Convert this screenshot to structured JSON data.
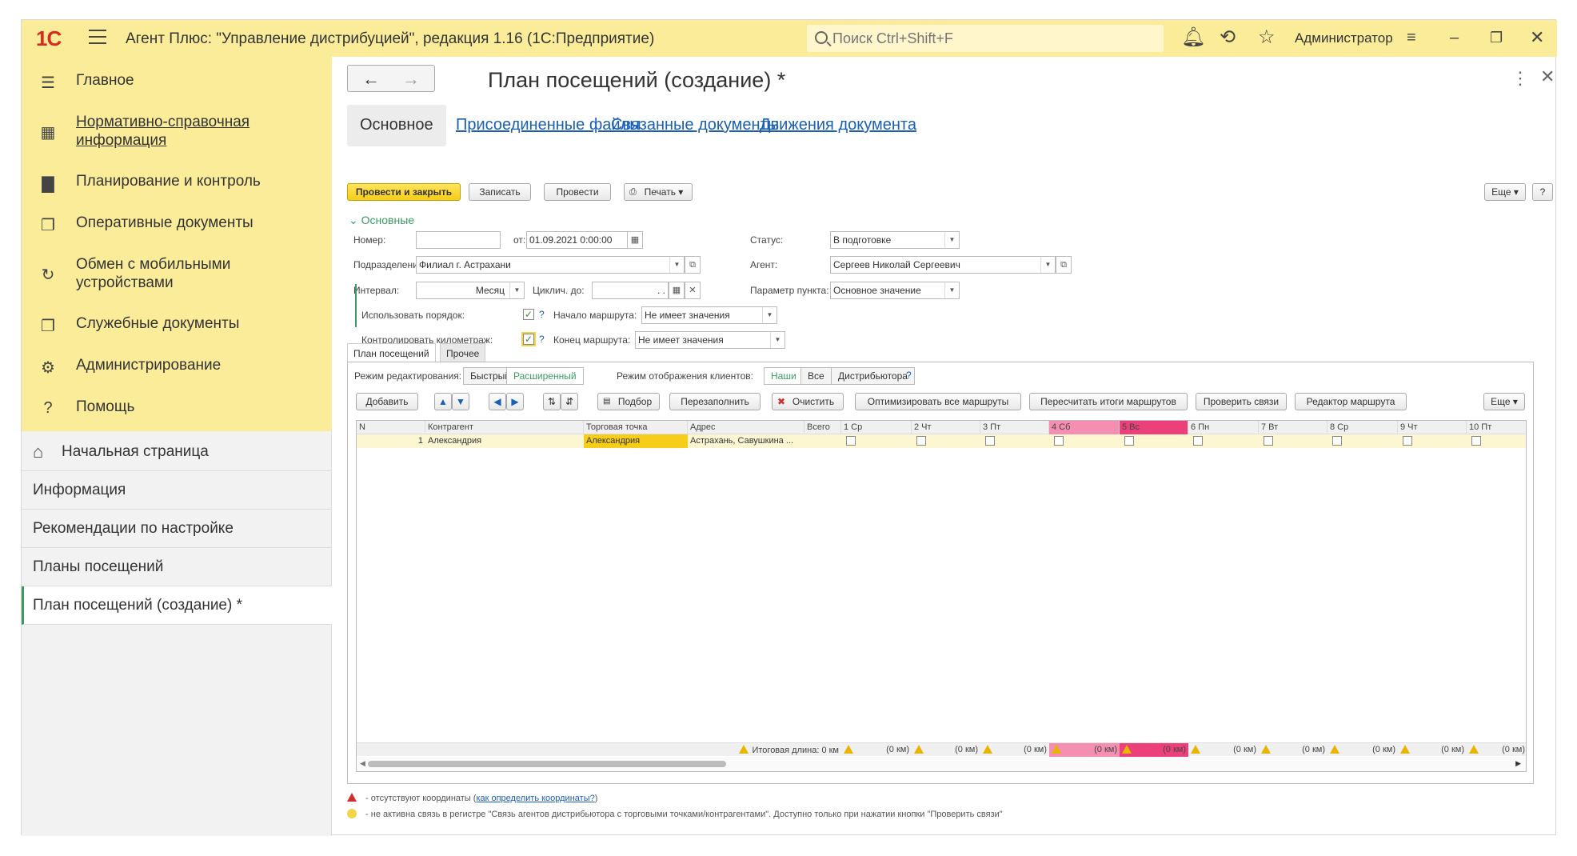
{
  "app": {
    "logo": "1С",
    "title": "Агент Плюс: \"Управление дистрибуцией\", редакция 1.16  (1С:Предприятие)",
    "search_placeholder": "Поиск Ctrl+Shift+F",
    "user": "Администратор"
  },
  "sidebar": {
    "items": [
      {
        "label": "Главное",
        "icon": "menu-lines-icon"
      },
      {
        "label": "Нормативно-справочная информация",
        "icon": "grid-table-icon"
      },
      {
        "label": "Планирование и контроль",
        "icon": "bar-chart-icon"
      },
      {
        "label": "Оперативные документы",
        "icon": "documents-icon"
      },
      {
        "label": "Обмен с мобильными устройствами",
        "icon": "sync-icon"
      },
      {
        "label": "Служебные документы",
        "icon": "service-documents-icon"
      },
      {
        "label": "Администрирование",
        "icon": "gear-icon"
      },
      {
        "label": "Помощь",
        "icon": "question-icon"
      }
    ],
    "open_tabs": [
      {
        "label": "Начальная страница",
        "icon": "home-icon"
      },
      {
        "label": "Информация"
      },
      {
        "label": "Рекомендации по настройке"
      },
      {
        "label": "Планы посещений"
      },
      {
        "label": "План посещений  (создание) *"
      }
    ]
  },
  "form": {
    "title": "План посещений  (создание) *",
    "tabs": [
      "Основное",
      "Присоединенные файлы",
      "Связанные документы",
      "Движения документа"
    ],
    "toolbar": {
      "post_close": "Провести и закрыть",
      "save": "Записать",
      "post": "Провести",
      "print": "Печать",
      "more": "Еще",
      "help": "?"
    },
    "section_title": "Основные",
    "fields": {
      "number_label": "Номер:",
      "number_value": "",
      "from_label": "от:",
      "from_value": "01.09.2021  0:00:00",
      "status_label": "Статус:",
      "status_value": "В подготовке",
      "division_label": "Подразделение:",
      "division_value": "Филиал г. Астрахани",
      "agent_label": "Агент:",
      "agent_value": "Сергеев Николай Сергеевич",
      "interval_label": "Интервал:",
      "interval_value": "Месяц",
      "cyclic_label": "Циклич. до:",
      "cyclic_value": "  .  .",
      "point_param_label": "Параметр пункта:",
      "point_param_value": "Основное значение",
      "use_order_label": "Использовать порядок:",
      "use_order_checked": true,
      "route_start_label": "Начало маршрута:",
      "route_start_value": "Не имеет значения",
      "control_km_label": "Контролировать километраж:",
      "control_km_checked": true,
      "route_end_label": "Конец маршрута:",
      "route_end_value": "Не имеет значения"
    },
    "inner_tabs": [
      "План посещений",
      "Прочее"
    ],
    "edit_mode_label": "Режим редактирования:",
    "edit_modes": [
      "Быстрый",
      "Расширенный"
    ],
    "client_mode_label": "Режим отображения клиентов:",
    "client_modes": [
      "Наши",
      "Все",
      "Дистрибьютора"
    ],
    "grid_toolbar": {
      "add": "Добавить",
      "pick": "Подбор",
      "refill": "Перезаполнить",
      "clear": "Очистить",
      "optimize": "Оптимизировать все маршруты",
      "recalc": "Пересчитать итоги маршрутов",
      "check_links": "Проверить связи",
      "route_editor": "Редактор маршрута",
      "more": "Еще"
    },
    "grid": {
      "columns": [
        "N",
        "Контрагент",
        "Торговая точка",
        "Адрес",
        "Всего",
        "1 Ср",
        "2 Чт",
        "3 Пт",
        "4 Сб",
        "5 Вс",
        "6 Пн",
        "7 Вт",
        "8 Ср",
        "9 Чт",
        "10 Пт"
      ],
      "rows": [
        {
          "n": "1",
          "counterparty": "Александрия",
          "outlet": "Александрия",
          "address": "Астрахань, Савушкина ...",
          "total": ""
        }
      ],
      "footer_total_label": "Итоговая длина: 0 км",
      "footer_day_value": "(0 км)"
    },
    "legend": {
      "line1_text": " - отсутствуют координаты (",
      "line1_link": "как определить координаты?",
      "line1_end": ")",
      "line2_text": " - не активна связь в регистре \"Связь агентов дистрибьютора с торговыми точками/контрагентами\". Доступно только при нажатии кнопки \"Проверить связи\""
    },
    "colors": {
      "topbar": "#fbec9a",
      "accent_green": "#3a9a62",
      "link_blue": "#1a5fb4",
      "saturday": "#f48fb1",
      "sunday": "#ec407a",
      "primary_button": "#f6cd18"
    }
  }
}
